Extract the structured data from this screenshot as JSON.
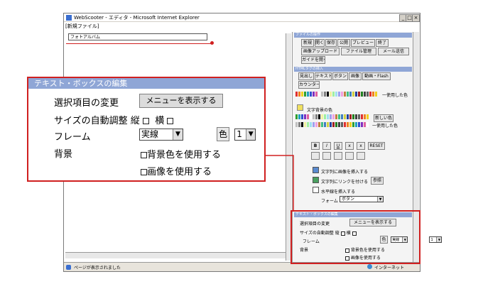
{
  "window": {
    "title": "WebScooter - エディタ - Microsoft Internet Explorer",
    "controls": [
      "_",
      "□",
      "×"
    ],
    "menu_text": "[新規ファイル]",
    "album_field": "フォトアルバム",
    "status": "ページが表示されました",
    "zone": "インターネット"
  },
  "side": {
    "file_ops_title": "ファイルの操作",
    "file_buttons": [
      "新規",
      "開く",
      "保存",
      "公開",
      "プレビュー",
      "終了"
    ],
    "file_buttons2": [
      "画像アップロード",
      "ファイル管理",
      "メール送信"
    ],
    "guide_btn": "ガイドを開く",
    "insert_title": "HTMLタグの挿入",
    "insert_buttons": [
      "見出し",
      "テキスト",
      "ボタン",
      "画像",
      "動画・Flash"
    ],
    "counter_btn": "カウンター",
    "used_color": "一使用した色",
    "text_bg_label": "文字背景の色",
    "new_color_btn": "新しい色",
    "used_color2": "一使用した色",
    "reset_btn": "RESET",
    "format_buttons": [
      "B",
      "I",
      "U",
      "x",
      "x"
    ],
    "insert_img_text": "文字列に画像を挿入する",
    "insert_link_text": "文字列にリンクを付ける",
    "ref_btn": "参照",
    "hr_text": "水平線を挿入する",
    "font_label": "フォーム",
    "font_value": "ボタン",
    "small_box_title": "テキスト・ボックスの編集",
    "small_change": "選択項目の変更",
    "small_menu_btn": "メニューを表示する",
    "small_auto": "サイズの自動調整",
    "small_v": "縦",
    "small_h": "横",
    "small_frame": "フレーム",
    "small_frame_val": "実線",
    "small_frame_num": "1",
    "small_color_btn": "色",
    "small_bg": "背景",
    "small_bg_color": "背景色を使用する",
    "small_bg_img": "画像を使用する"
  },
  "callout": {
    "title": "テキスト・ボックスの編集",
    "change_label": "選択項目の変更",
    "menu_btn": "メニューを表示する",
    "auto_label": "サイズの自動調整",
    "vertical": "縦",
    "horizontal": "横",
    "frame_label": "フレーム",
    "frame_style": "実線",
    "frame_width": "1",
    "color_btn": "色",
    "bg_label": "背景",
    "bg_color": "背景色を使用する",
    "bg_image": "画像を使用する"
  },
  "colors": {
    "accent_red": "#d02020",
    "panel_blue": "#8fa6d6",
    "swatches": [
      "#e03030",
      "#f08020",
      "#f0d020",
      "#30a030",
      "#20a0c0",
      "#3050d0",
      "#8030c0",
      "#e060a0",
      "#ffffff",
      "#c0c0c0",
      "#808080",
      "#000000",
      "#f0f0a0",
      "#a0f0a0",
      "#a0e0f0",
      "#a0a0f0",
      "#f0a0e0",
      "#c08040",
      "#40c080",
      "#4080c0",
      "#d0d040",
      "#2040a0",
      "#a02020",
      "#208020",
      "#404040",
      "#606060"
    ]
  }
}
